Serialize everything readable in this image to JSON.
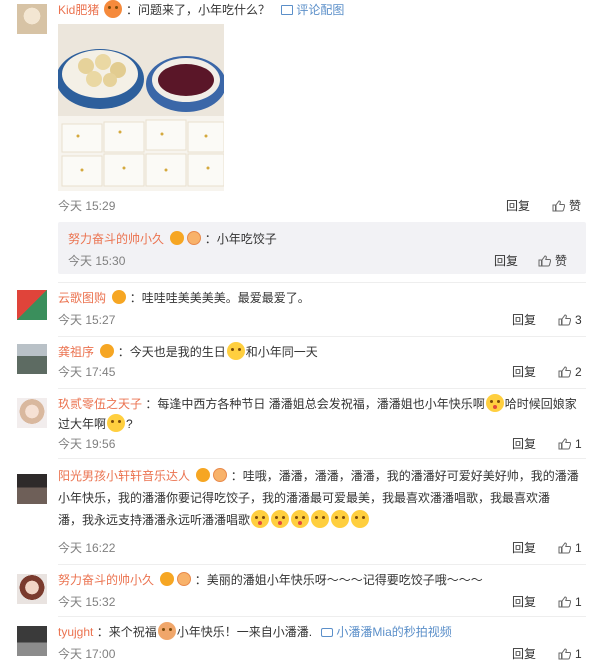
{
  "comments": [
    {
      "username": "Kid肥猪",
      "text": "：问题来了，小年吃什么？",
      "pic_link": "评论配图",
      "time": "今天 15:29",
      "reply_label": "回复",
      "like_label": "赞",
      "sub_reply": {
        "username": "努力奋斗的帅小久",
        "text": "：小年吃饺子",
        "time": "今天 15:30",
        "reply_label": "回复",
        "like_label": "赞"
      }
    },
    {
      "username": "云歌图购",
      "text": "：哇哇哇美美美美。最爱最爱了。",
      "time": "今天 15:27",
      "reply_label": "回复",
      "like_count": "3"
    },
    {
      "username": "龚祖序",
      "text_a": "：今天也是我的生日",
      "text_b": "和小年同一天",
      "time": "今天 17:45",
      "reply_label": "回复",
      "like_count": "2"
    },
    {
      "username": "玖贰零伍之天子",
      "text_a": "：每逢中西方各种节日 潘潘姐总会发祝福，潘潘姐也小年快乐啊",
      "text_b": "哈时候回娘家",
      "text_c": "过大年啊",
      "text_d": "?",
      "time": "今天 19:56",
      "reply_label": "回复",
      "like_count": "1"
    },
    {
      "username": "阳光男孩小轩轩音乐达人",
      "text_a": "：哇哦，潘潘，潘潘，潘潘，我的潘潘好可爱好美好帅，我的潘潘",
      "text_b": "小年快乐，我的潘潘你要记得吃饺子，我的潘潘最可爱最美，我最喜欢潘潘唱歌，我最喜欢潘",
      "text_c": "潘，我永远支持潘潘永远听潘潘唱歌",
      "time": "今天 16:22",
      "reply_label": "回复",
      "like_count": "1"
    },
    {
      "username": "努力奋斗的帅小久",
      "text": "：美丽的潘姐小年快乐呀～～～记得要吃饺子哦～～～",
      "time": "今天 15:32",
      "reply_label": "回复",
      "like_count": "1"
    },
    {
      "username": "tyujght",
      "text_a": "：来个祝福",
      "text_b": "小年快乐！一来自小潘潘.",
      "video_link": "小潘潘Mia的秒拍视频",
      "time": "今天 17:00",
      "reply_label": "回复",
      "like_count": "1"
    }
  ]
}
